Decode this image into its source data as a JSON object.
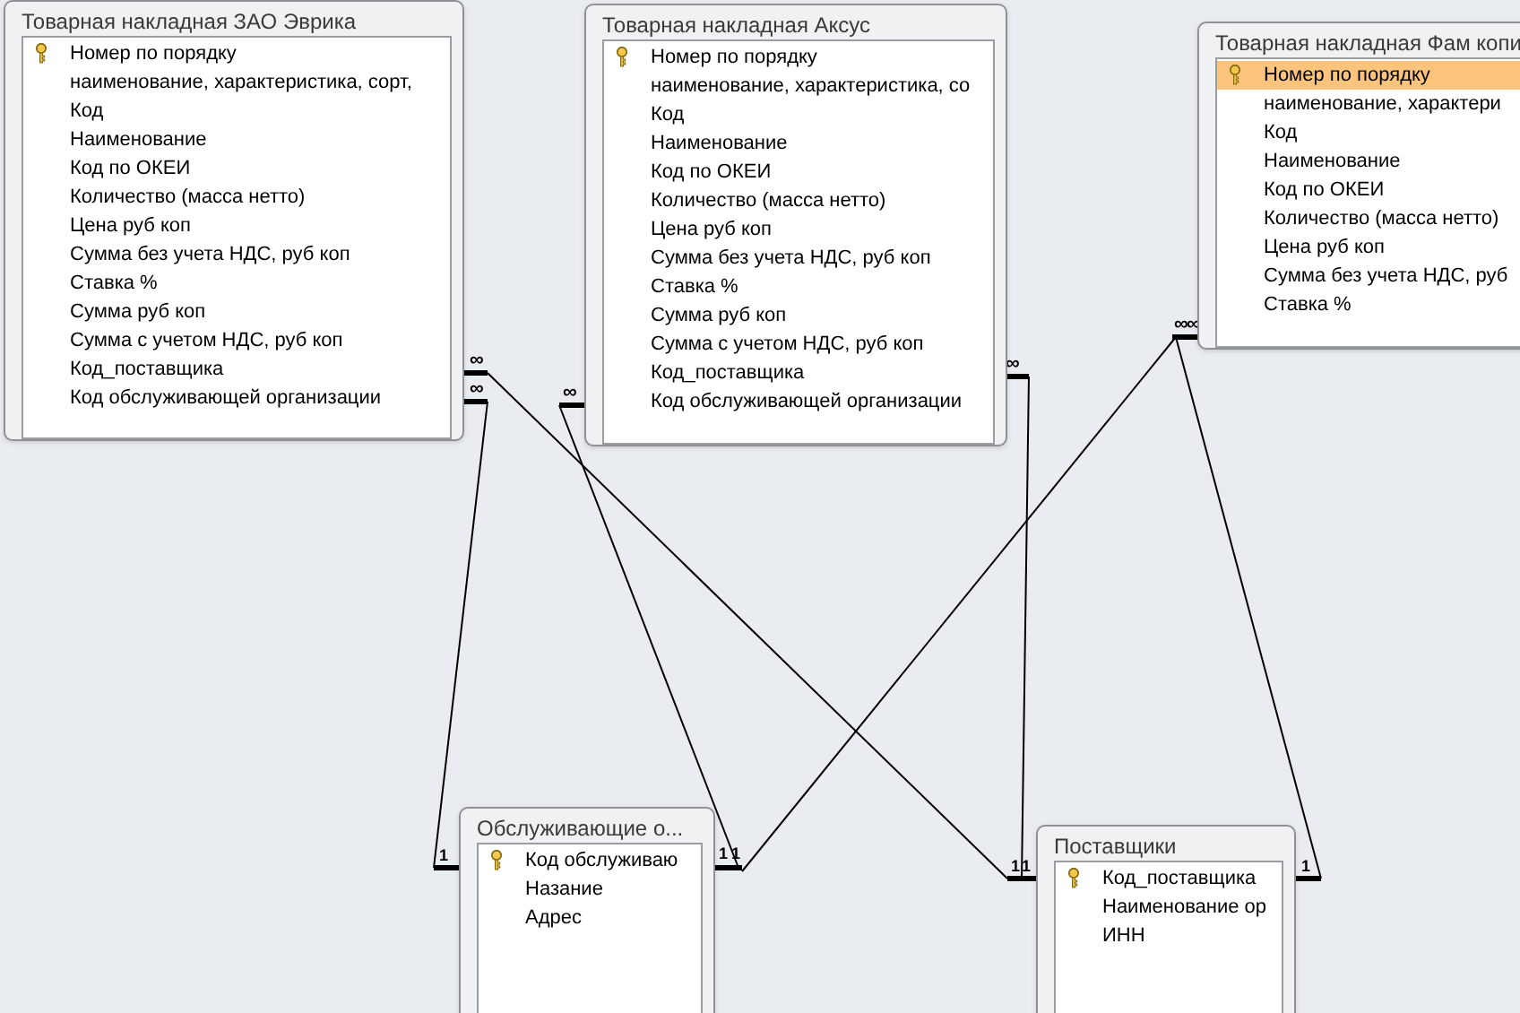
{
  "tables": [
    {
      "title": "Товарная накладная ЗАО Эврика",
      "fields": [
        {
          "name": "Номер по порядку",
          "key": true,
          "selected": false
        },
        {
          "name": "наименование, характеристика, сорт,",
          "key": false,
          "selected": false
        },
        {
          "name": "Код",
          "key": false,
          "selected": false
        },
        {
          "name": "Наименование",
          "key": false,
          "selected": false
        },
        {
          "name": "Код по ОКЕИ",
          "key": false,
          "selected": false
        },
        {
          "name": "Количество (масса нетто)",
          "key": false,
          "selected": false
        },
        {
          "name": "Цена руб коп",
          "key": false,
          "selected": false
        },
        {
          "name": "Сумма без учета НДС, руб коп",
          "key": false,
          "selected": false
        },
        {
          "name": "Ставка %",
          "key": false,
          "selected": false
        },
        {
          "name": "Сумма руб коп",
          "key": false,
          "selected": false
        },
        {
          "name": "Сумма с учетом НДС, руб коп",
          "key": false,
          "selected": false
        },
        {
          "name": "Код_поставщика",
          "key": false,
          "selected": false
        },
        {
          "name": "Код обслуживающей организации",
          "key": false,
          "selected": false
        }
      ]
    },
    {
      "title": "Товарная накладная Аксус",
      "fields": [
        {
          "name": "Номер по порядку",
          "key": true,
          "selected": false
        },
        {
          "name": "наименование, характеристика, со",
          "key": false,
          "selected": false
        },
        {
          "name": "Код",
          "key": false,
          "selected": false
        },
        {
          "name": "Наименование",
          "key": false,
          "selected": false
        },
        {
          "name": "Код по ОКЕИ",
          "key": false,
          "selected": false
        },
        {
          "name": "Количество (масса нетто)",
          "key": false,
          "selected": false
        },
        {
          "name": "Цена руб коп",
          "key": false,
          "selected": false
        },
        {
          "name": "Сумма без учета НДС, руб коп",
          "key": false,
          "selected": false
        },
        {
          "name": "Ставка %",
          "key": false,
          "selected": false
        },
        {
          "name": "Сумма руб коп",
          "key": false,
          "selected": false
        },
        {
          "name": "Сумма с учетом НДС, руб коп",
          "key": false,
          "selected": false
        },
        {
          "name": "Код_поставщика",
          "key": false,
          "selected": false
        },
        {
          "name": "Код обслуживающей организации",
          "key": false,
          "selected": false
        }
      ]
    },
    {
      "title": "Товарная накладная Фам копи",
      "fields": [
        {
          "name": "Номер по порядку",
          "key": true,
          "selected": true
        },
        {
          "name": "наименование, характери",
          "key": false,
          "selected": false
        },
        {
          "name": "Код",
          "key": false,
          "selected": false
        },
        {
          "name": "Наименование",
          "key": false,
          "selected": false
        },
        {
          "name": "Код по ОКЕИ",
          "key": false,
          "selected": false
        },
        {
          "name": "Количество (масса нетто)",
          "key": false,
          "selected": false
        },
        {
          "name": "Цена руб коп",
          "key": false,
          "selected": false
        },
        {
          "name": "Сумма без учета НДС, руб",
          "key": false,
          "selected": false
        },
        {
          "name": "Ставка %",
          "key": false,
          "selected": false
        }
      ]
    },
    {
      "title": "Обслуживающие о...",
      "fields": [
        {
          "name": "Код обслуживаю",
          "key": true,
          "selected": false
        },
        {
          "name": "Назание",
          "key": false,
          "selected": false
        },
        {
          "name": "Адрес",
          "key": false,
          "selected": false
        }
      ]
    },
    {
      "title": "Поставщики",
      "fields": [
        {
          "name": "Код_поставщика",
          "key": true,
          "selected": false
        },
        {
          "name": "Наименование ор",
          "key": false,
          "selected": false
        },
        {
          "name": "ИНН",
          "key": false,
          "selected": false
        }
      ]
    }
  ],
  "relationships": [
    {
      "from_label": "∞",
      "to_label": "1"
    },
    {
      "from_label": "∞",
      "to_label": "1"
    },
    {
      "from_label": "∞",
      "to_label": "1"
    },
    {
      "from_label": "∞",
      "to_label": "1"
    },
    {
      "from_label": "∞",
      "to_label": "1"
    },
    {
      "from_label": "∞",
      "to_label": "1"
    }
  ]
}
